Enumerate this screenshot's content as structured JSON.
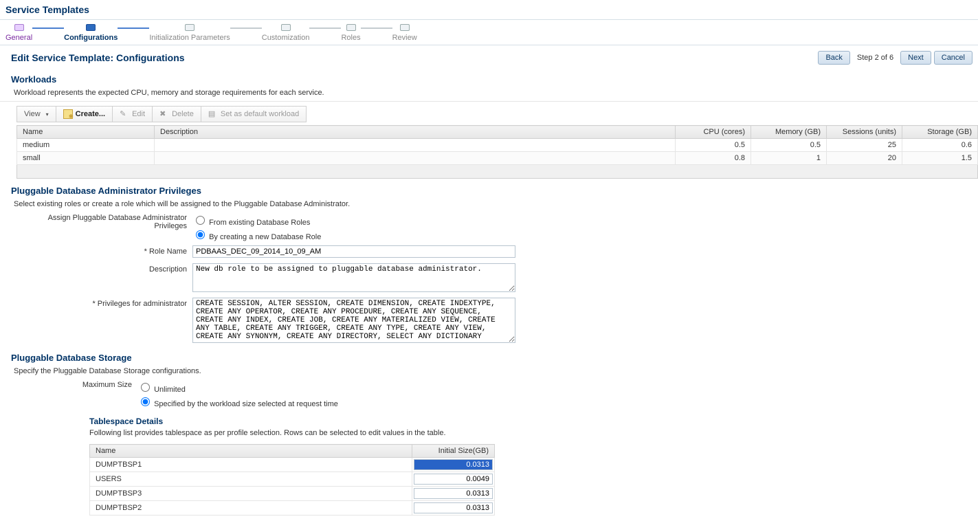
{
  "pageTitle": "Service Templates",
  "wizard": {
    "steps": [
      {
        "label": "General",
        "state": "done"
      },
      {
        "label": "Configurations",
        "state": "current"
      },
      {
        "label": "Initialization Parameters",
        "state": "future-blue"
      },
      {
        "label": "Customization",
        "state": "future"
      },
      {
        "label": "Roles",
        "state": "future"
      },
      {
        "label": "Review",
        "state": "future"
      }
    ]
  },
  "subtitle": "Edit Service Template: Configurations",
  "nav": {
    "back": "Back",
    "step": "Step 2 of 6",
    "next": "Next",
    "cancel": "Cancel"
  },
  "workloads": {
    "heading": "Workloads",
    "desc": "Workload represents the expected CPU, memory and storage requirements for each service.",
    "toolbar": {
      "view": "View",
      "create": "Create...",
      "edit": "Edit",
      "delete": "Delete",
      "setdef": "Set as default workload"
    },
    "cols": {
      "name": "Name",
      "desc": "Description",
      "cpu": "CPU (cores)",
      "mem": "Memory (GB)",
      "sess": "Sessions (units)",
      "stor": "Storage (GB)"
    },
    "rows": [
      {
        "name": "medium",
        "desc": "",
        "cpu": "0.5",
        "mem": "0.5",
        "sess": "25",
        "stor": "0.6"
      },
      {
        "name": "small",
        "desc": "",
        "cpu": "0.8",
        "mem": "1",
        "sess": "20",
        "stor": "1.5"
      }
    ]
  },
  "priv": {
    "heading": "Pluggable Database Administrator Privileges",
    "desc": "Select existing roles or create a role which will be assigned to the Pluggable Database Administrator.",
    "assignLabel": "Assign Pluggable Database Administrator Privileges",
    "opt1": "From existing Database Roles",
    "opt2": "By creating a new Database Role",
    "roleNameLabel": "Role Name",
    "roleName": "PDBAAS_DEC_09_2014_10_09_AM",
    "descLabel": "Description",
    "descVal": "New db role to be assigned to pluggable database administrator.",
    "privsLabel": "Privileges for administrator",
    "privsVal": "CREATE SESSION, ALTER SESSION, CREATE DIMENSION, CREATE INDEXTYPE, CREATE ANY OPERATOR, CREATE ANY PROCEDURE, CREATE ANY SEQUENCE, CREATE ANY INDEX, CREATE JOB, CREATE ANY MATERIALIZED VIEW, CREATE ANY TABLE, CREATE ANY TRIGGER, CREATE ANY TYPE, CREATE ANY VIEW, CREATE ANY SYNONYM, CREATE ANY DIRECTORY, SELECT ANY DICTIONARY"
  },
  "storage": {
    "heading": "Pluggable Database Storage",
    "desc": "Specify the Pluggable Database Storage configurations.",
    "maxLabel": "Maximum Size",
    "opt1": "Unlimited",
    "opt2": "Specified by the workload size selected at request time",
    "ts": {
      "heading": "Tablespace Details",
      "desc": "Following list provides tablespace as per profile selection. Rows can be selected to edit values in the table.",
      "cols": {
        "name": "Name",
        "size": "Initial Size(GB)"
      },
      "rows": [
        {
          "name": "DUMPTBSP1",
          "size": "0.0313",
          "selected": true
        },
        {
          "name": "USERS",
          "size": "0.0049"
        },
        {
          "name": "DUMPTBSP3",
          "size": "0.0313"
        },
        {
          "name": "DUMPTBSP2",
          "size": "0.0313"
        }
      ]
    }
  }
}
